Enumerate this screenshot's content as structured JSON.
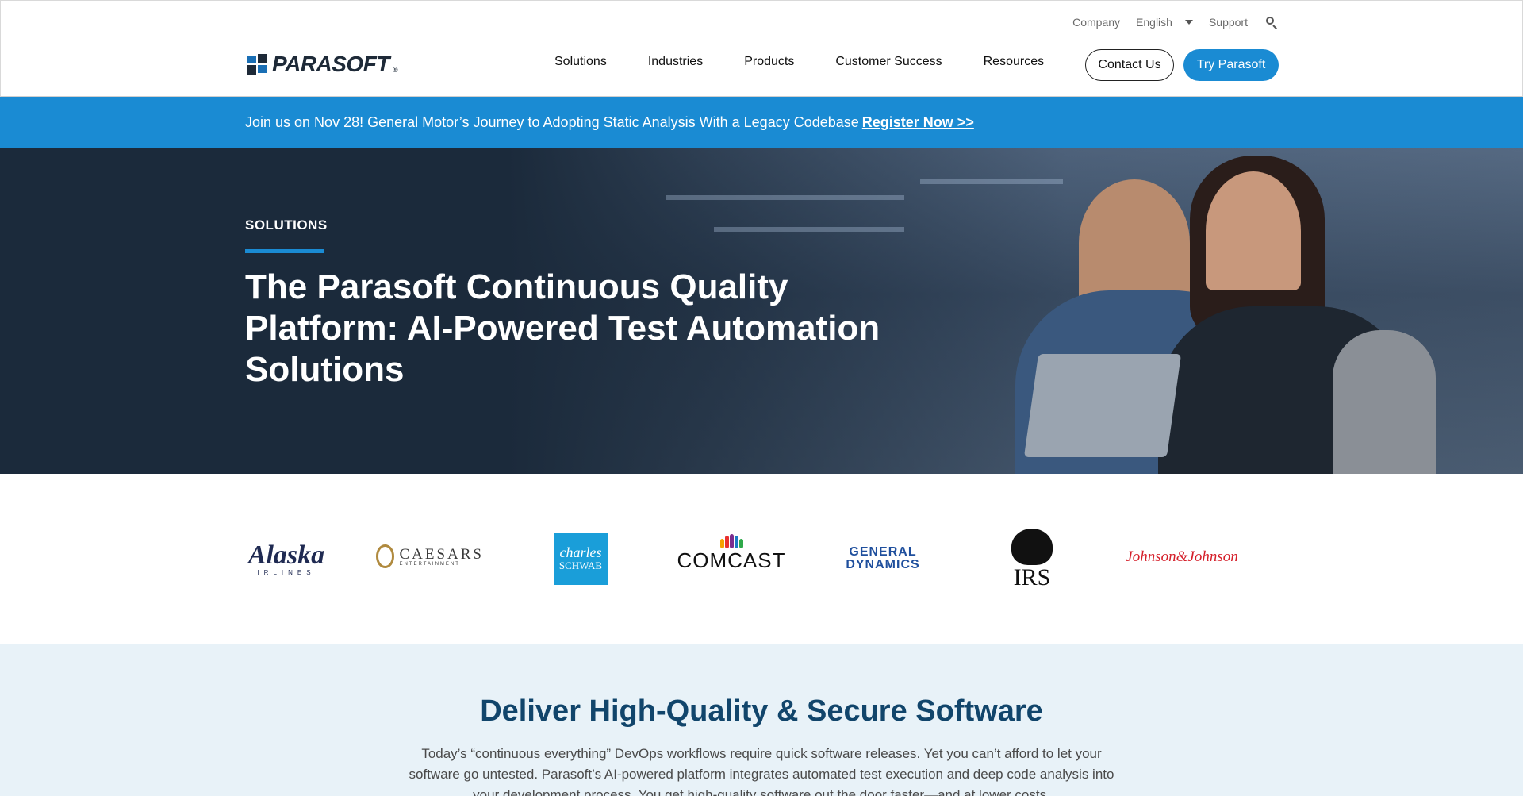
{
  "header": {
    "utility": {
      "company": "Company",
      "language": "English",
      "support": "Support"
    },
    "logo_text": "PARASOFT",
    "logo_reg": "®",
    "nav": [
      "Solutions",
      "Industries",
      "Products",
      "Customer Success",
      "Resources"
    ],
    "contact_label": "Contact Us",
    "try_label": "Try Parasoft"
  },
  "announcement": {
    "text": "Join us on Nov 28! General Motor’s Journey to Adopting Static Analysis With a Legacy Codebase",
    "link": "Register Now >>"
  },
  "hero": {
    "eyebrow": "SOLUTIONS",
    "title": "The Parasoft Continuous Quality Platform: AI-Powered Test Automation Solutions"
  },
  "client_logos": {
    "alaska": "Alaska",
    "alaska_sub": "IRLINES",
    "caesars": "CAESARS",
    "caesars_sub": "ENTERTAINMENT",
    "schwab_top": "charles",
    "schwab_bottom": "SCHWAB",
    "comcast": "COMCAST",
    "gd_top": "GENERAL",
    "gd_bottom": "DYNAMICS",
    "irs": "IRS",
    "jnj": "Johnson&Johnson"
  },
  "deliver": {
    "title": "Deliver High-Quality & Secure Software",
    "body": "Today’s “continuous everything” DevOps workflows require quick software releases. Yet you can’t afford to let your software go untested. Parasoft’s AI-powered platform integrates automated test execution and deep code analysis into your development process. You get high-quality software out the door faster—and at lower costs."
  },
  "colors": {
    "brand_blue": "#1a8bd3",
    "navy": "#11456b",
    "hero_bg": "#1b2a3b"
  }
}
